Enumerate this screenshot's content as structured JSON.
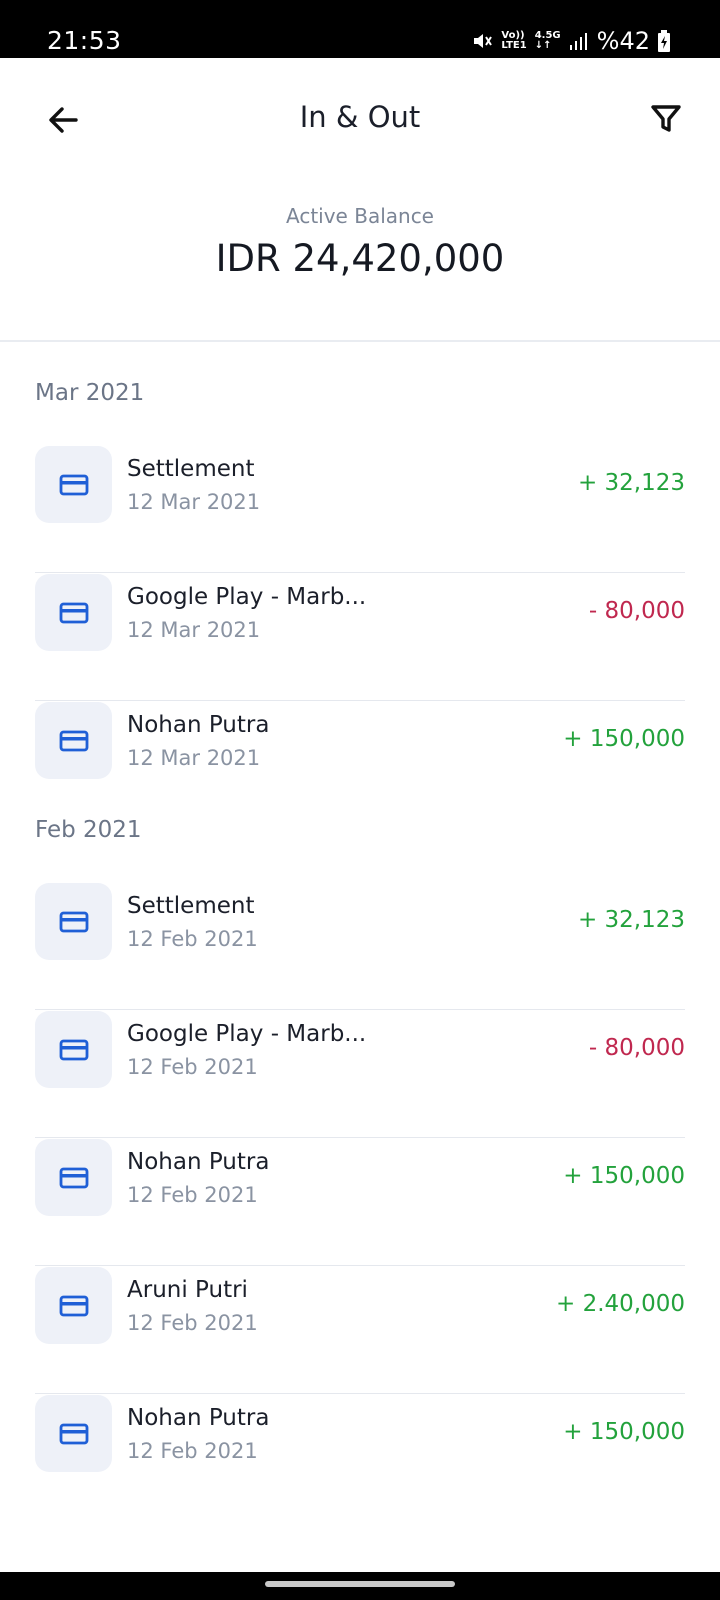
{
  "status_bar": {
    "time": "21:53",
    "net_top": "Vo))",
    "net_bottom": "LTE1",
    "net_type": "4.5G",
    "battery": "%42"
  },
  "header": {
    "title": "In & Out",
    "back_icon": "arrow-left-icon",
    "filter_icon": "filter-icon"
  },
  "balance": {
    "label": "Active Balance",
    "value": "IDR 24,420,000"
  },
  "colors": {
    "positive": "#23a23c",
    "negative": "#c0284f",
    "icon_blue": "#1f5fd6",
    "icon_bg": "#eef1f8"
  },
  "groups": [
    {
      "month": "Mar 2021",
      "transactions": [
        {
          "name": "Settlement",
          "date": "12 Mar 2021",
          "amount": "+ 32,123",
          "direction": "in",
          "icon": "credit-card-icon"
        },
        {
          "name": "Google Play - Marb...",
          "date": "12 Mar 2021",
          "amount": "- 80,000",
          "direction": "out",
          "icon": "credit-card-icon"
        },
        {
          "name": "Nohan Putra",
          "date": "12 Mar 2021",
          "amount": "+ 150,000",
          "direction": "in",
          "icon": "credit-card-icon"
        }
      ]
    },
    {
      "month": "Feb 2021",
      "transactions": [
        {
          "name": "Settlement",
          "date": "12 Feb 2021",
          "amount": "+ 32,123",
          "direction": "in",
          "icon": "credit-card-icon"
        },
        {
          "name": "Google Play - Marb...",
          "date": "12 Feb 2021",
          "amount": "- 80,000",
          "direction": "out",
          "icon": "credit-card-icon"
        },
        {
          "name": "Nohan Putra",
          "date": "12 Feb 2021",
          "amount": "+ 150,000",
          "direction": "in",
          "icon": "credit-card-icon"
        },
        {
          "name": "Aruni Putri",
          "date": "12 Feb 2021",
          "amount": "+ 2.40,000",
          "direction": "in",
          "icon": "credit-card-icon"
        },
        {
          "name": "Nohan Putra",
          "date": "12 Feb 2021",
          "amount": "+ 150,000",
          "direction": "in",
          "icon": "credit-card-icon"
        }
      ]
    }
  ]
}
